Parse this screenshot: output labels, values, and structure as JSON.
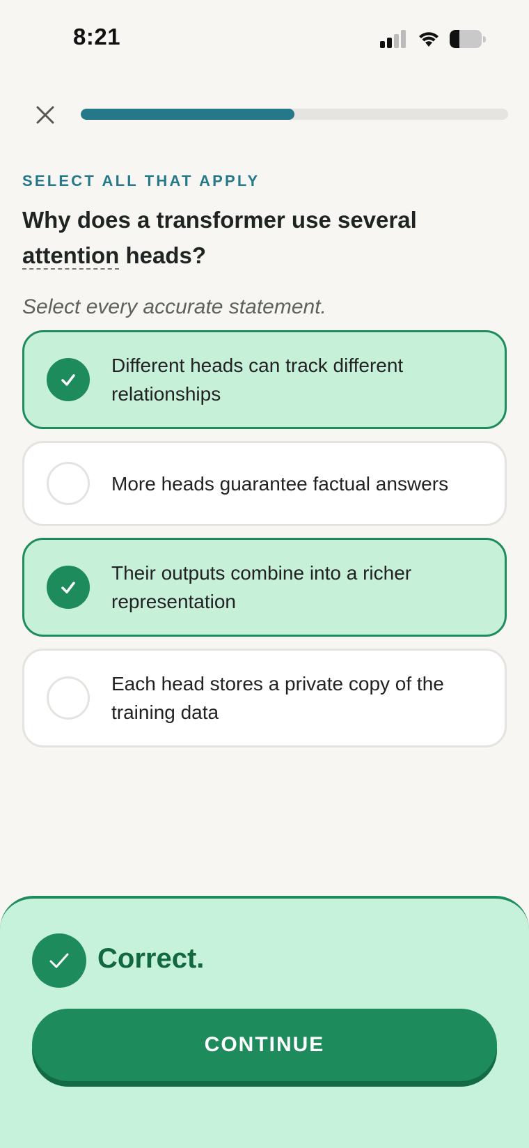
{
  "status_bar": {
    "time": "8:21",
    "battery_level": 0.3
  },
  "top_bar": {
    "close_icon": "close-icon",
    "progress": 0.5
  },
  "question": {
    "eyebrow": "SELECT ALL THAT APPLY",
    "title_before": "Why does a transformer use several ",
    "title_term": "attention",
    "title_after": " heads?",
    "instructions": "Select every accurate statement."
  },
  "options": [
    {
      "label": "Different heads can track different relationships",
      "selected": true
    },
    {
      "label": "More heads guarantee factual answers",
      "selected": false
    },
    {
      "label": "Their outputs combine into a richer representation",
      "selected": true
    },
    {
      "label": "Each head stores a private copy of the training data",
      "selected": false
    }
  ],
  "feedback": {
    "result": "Correct.",
    "continue_label": "CONTINUE",
    "icon": "check-icon"
  },
  "colors": {
    "accent_teal": "#25788a",
    "correct_green": "#1e8b5c",
    "selected_bg": "#c7f0d9"
  }
}
